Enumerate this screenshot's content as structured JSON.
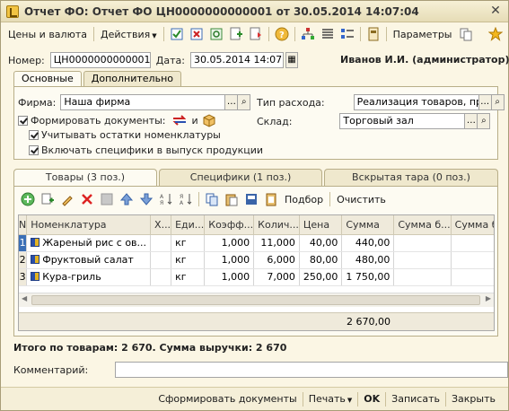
{
  "window": {
    "title": "Отчет ФО: Отчет ФО ЦН0000000000001 от 30.05.2014 14:07:04",
    "close_glyph": "✕"
  },
  "toolbar": {
    "prices_label": "Цены и валюта",
    "actions_label": "Действия",
    "params_label": "Параметры"
  },
  "header": {
    "number_label": "Номер:",
    "number_value": "ЦН0000000000001",
    "date_label": "Дата:",
    "date_value": "30.05.2014 14:07:04",
    "user": "Иванов И.И. (администратор)"
  },
  "top_tabs": [
    {
      "label": "Основные",
      "active": true
    },
    {
      "label": "Дополнительно",
      "active": false
    }
  ],
  "main": {
    "firm_label": "Фирма:",
    "firm_value": "Наша фирма",
    "expense_label": "Тип расхода:",
    "expense_value": "Реализация товаров, продукции",
    "warehouse_label": "Склад:",
    "warehouse_value": "Торговый зал",
    "form_docs_label": "Формировать документы:",
    "and_label": "и",
    "chk_rest_label": "Учитывать остатки номенклатуры",
    "chk_spec_label": "Включать специфики в выпуск продукции"
  },
  "mid_tabs": [
    {
      "label": "Товары (3 поз.)",
      "active": true
    },
    {
      "label": "Специфики (1 поз.)",
      "active": false
    },
    {
      "label": "Вскрытая тара (0 поз.)",
      "active": false
    }
  ],
  "grid_toolbar": {
    "pick_label": "Подбор",
    "clear_label": "Очистить"
  },
  "grid": {
    "columns": [
      "N",
      "Номенклатура",
      "Х...",
      "Еди...",
      "Коэфф...",
      "Колич...",
      "Цена",
      "Сумма",
      "Сумма б...",
      "Сумма б..."
    ],
    "rows": [
      {
        "n": "1",
        "name": "Жареный рис с ов...",
        "unit": "кг",
        "coef": "1,000",
        "qty": "11,000",
        "price": "40,00",
        "sum": "440,00"
      },
      {
        "n": "2",
        "name": "Фруктовый салат",
        "unit": "кг",
        "coef": "1,000",
        "qty": "6,000",
        "price": "80,00",
        "sum": "480,00"
      },
      {
        "n": "3",
        "name": "Кура-гриль",
        "unit": "кг",
        "coef": "1,000",
        "qty": "7,000",
        "price": "250,00",
        "sum": "1 750,00"
      }
    ],
    "total_sum": "2 670,00"
  },
  "summary": "Итого по товарам: 2 670. Сумма выручки: 2 670",
  "comment_label": "Комментарий:",
  "comment_value": "",
  "bottom": {
    "form_docs": "Сформировать документы",
    "print": "Печать",
    "ok": "OK",
    "save": "Записать",
    "close": "Закрыть"
  },
  "colors": {
    "window_bg": "#fbf6e4",
    "selection": "#3b6fb6"
  }
}
